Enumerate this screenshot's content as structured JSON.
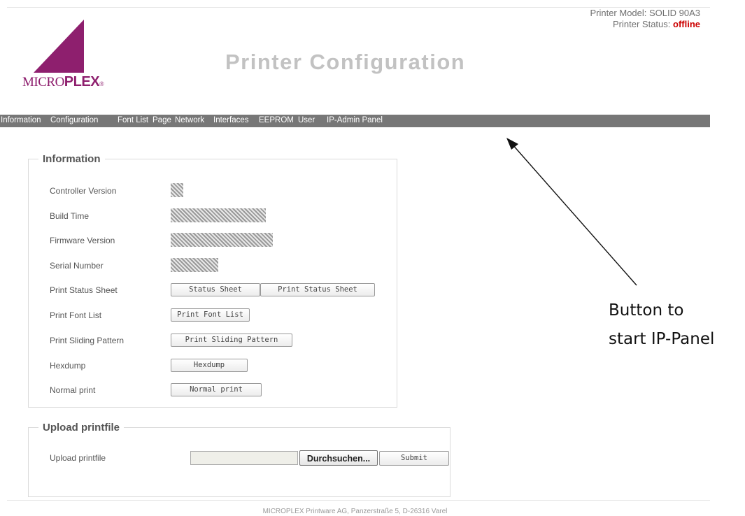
{
  "header": {
    "printer_model_label": "Printer Model: SOLID 90A3",
    "printer_status_label": "Printer Status: ",
    "printer_status_value": "offline",
    "title": "Printer Configuration"
  },
  "logo": {
    "part1": "MICRO",
    "part2": "P",
    "part3": "LEX",
    "reg": "®"
  },
  "nav": {
    "items": [
      "Information",
      "Configuration",
      "Font List",
      "Page",
      "Network",
      "Interfaces",
      "EEPROM",
      "User",
      "IP-Admin Panel"
    ]
  },
  "information": {
    "legend": "Information",
    "rows": [
      {
        "label": "Controller Version"
      },
      {
        "label": "Build Time"
      },
      {
        "label": "Firmware Version"
      },
      {
        "label": "Serial Number"
      },
      {
        "label": "Print Status Sheet",
        "buttons": [
          "Status Sheet",
          "Print Status Sheet"
        ]
      },
      {
        "label": "Print Font List",
        "buttons": [
          "Print Font List"
        ]
      },
      {
        "label": "Print Sliding Pattern",
        "buttons": [
          "Print Sliding Pattern"
        ]
      },
      {
        "label": "Hexdump",
        "buttons": [
          "Hexdump"
        ]
      },
      {
        "label": "Normal print",
        "buttons": [
          "Normal print"
        ]
      }
    ]
  },
  "upload": {
    "legend": "Upload printfile",
    "label": "Upload printfile",
    "file_value": "",
    "browse_label": "Durchsuchen...",
    "submit_label": "Submit"
  },
  "footer": {
    "text": "MICROPLEX Printware AG, Panzerstraße 5, D-26316 Varel"
  },
  "annotation": {
    "line1": "Button to",
    "line2": "start IP-Panel"
  },
  "colors": {
    "brand": "#8e1f6e",
    "nav_bg": "#777777",
    "status_offline": "#cc0000"
  }
}
